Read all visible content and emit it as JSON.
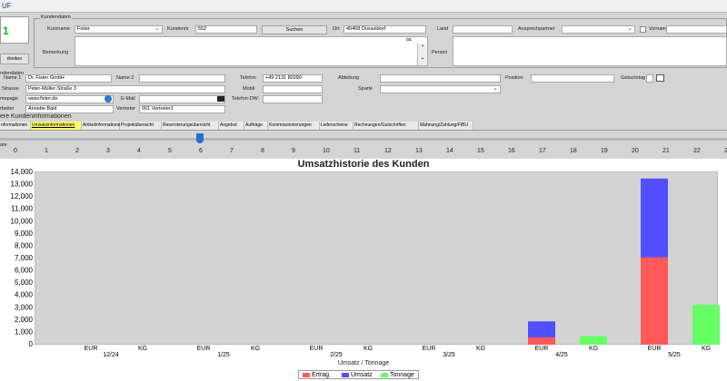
{
  "window": {
    "title": "UF"
  },
  "left": {
    "counter": "1",
    "edit_label": "rbeiten"
  },
  "customer": {
    "group_title": "Kundendaten",
    "shortname_label": "Kurzname",
    "shortname": "Fister",
    "custno_label": "Kundennr",
    "custno": "552",
    "search_label": "Suchen",
    "place_label": "Ort",
    "place": "40468 Düsseldorf",
    "country_label": "Land",
    "country": "",
    "contact_label": "Ansprechpartner",
    "contact": "",
    "firstname_label": "Vorname",
    "firstname": "",
    "remark_label": "Bemerkung",
    "remark": "",
    "person_label": "Person"
  },
  "details": {
    "name1_label": "Name 1",
    "name1": "Dr. Fister GmbH",
    "name2_label": "Name 2",
    "name2": "",
    "street_label": "Strasse",
    "street": "Peter-Müller-Straße 3",
    "homepage_label": "mepage",
    "homepage": "www.fister.de",
    "email_label": "E-Mail",
    "email": "",
    "agent_label": "rbeiter",
    "agent": "Annette Bald",
    "rep_label": "Vertreter",
    "rep": "001 Vertreter1",
    "phone_label": "Telefon",
    "phone": "+49 2131 82090",
    "mobile_label": "Mobil",
    "mobile": "",
    "phonedw_label": "Telefon-DW:",
    "phonedw": "",
    "dept_label": "Abteilung",
    "dept": "",
    "branch_label": "Sparte",
    "branch": "",
    "position_label": "Position",
    "position": "",
    "birthday_label": "Geburtstag",
    "birthday": "",
    "section_label": "ndendaten"
  },
  "more": {
    "title": "ere Kundeninformationen"
  },
  "tabs": [
    "nformationen",
    "Umsatzinformationen",
    "Artikelinformationen",
    "Projektübersicht",
    "Reservierungsübersicht",
    "Angebot",
    "Aufträge",
    "Kommissionierungen",
    "Lieferscheine",
    "Rechnungen/Gutschriften",
    "Mahnung/Zahlung/FIBU"
  ],
  "slider": {
    "label": "ate",
    "ticks": [
      "0",
      "1",
      "2",
      "3",
      "4",
      "5",
      "6",
      "7",
      "8",
      "9",
      "10",
      "11",
      "12",
      "13",
      "14",
      "15",
      "16",
      "17",
      "18",
      "19",
      "20",
      "21",
      "22",
      "23"
    ],
    "value": 6
  },
  "colors": {
    "ertrag": "#ff5a5a",
    "umsatz": "#4f4fff",
    "tonnage": "#66ff66"
  },
  "chart_data": {
    "type": "bar",
    "title": "Umsatzhistorie des Kunden",
    "xlabel": "Umsatz / Tonnage",
    "ylabel": "",
    "ylim": [
      0,
      14000
    ],
    "yticks": [
      "0",
      "1,000",
      "2,000",
      "3,000",
      "4,000",
      "5,000",
      "6,000",
      "7,000",
      "8,000",
      "9,000",
      "10,000",
      "11,000",
      "12,000",
      "13,000",
      "14,000"
    ],
    "categories": [
      "12/24",
      "1/25",
      "2/25",
      "3/25",
      "4/25",
      "5/25"
    ],
    "sublabels": [
      "EUR",
      "KG"
    ],
    "series": [
      {
        "name": "Ertrag",
        "values": [
          0,
          0,
          0,
          0,
          600,
          7100
        ]
      },
      {
        "name": "Umsatz",
        "values": [
          0,
          0,
          0,
          0,
          1900,
          13500
        ]
      },
      {
        "name": "Tonnage",
        "values": [
          0,
          0,
          0,
          0,
          700,
          3250
        ]
      }
    ],
    "legend": "bottom",
    "grid": false
  }
}
